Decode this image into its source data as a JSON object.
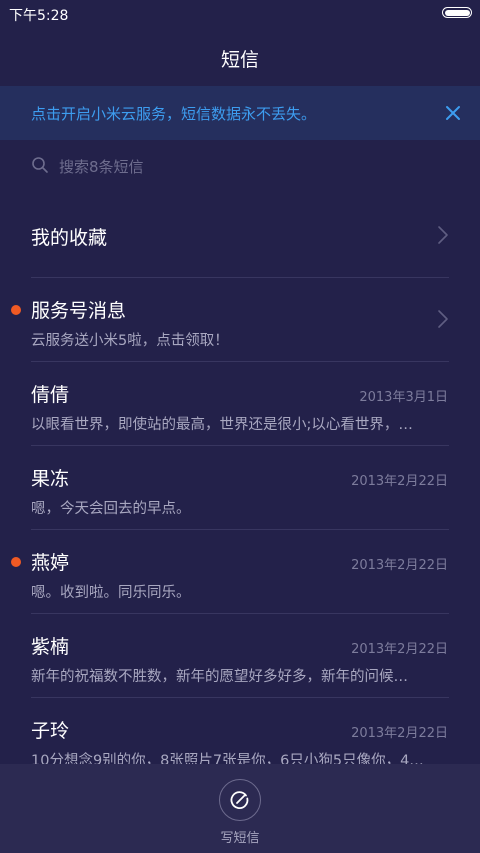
{
  "status_bar": {
    "time": "下午5:28",
    "battery_level": 1.0
  },
  "header": {
    "title": "短信"
  },
  "banner": {
    "text": "点击开启小米云服务，短信数据永不丢失。",
    "accent_color": "#3d9df0"
  },
  "search": {
    "placeholder": "搜索8条短信"
  },
  "favorites": {
    "label": "我的收藏"
  },
  "conversations": [
    {
      "name": "服务号消息",
      "preview": "云服务送小米5啦，点击领取！",
      "date": "",
      "unread": true,
      "has_chevron": true
    },
    {
      "name": "倩倩",
      "preview": "以眼看世界，即使站的最高，世界还是很小;以心看世界，…",
      "date": "2013年3月1日",
      "unread": false
    },
    {
      "name": "果冻",
      "preview": "嗯，今天会回去的早点。",
      "date": "2013年2月22日",
      "unread": false
    },
    {
      "name": "燕婷",
      "preview": "嗯。收到啦。同乐同乐。",
      "date": "2013年2月22日",
      "unread": true
    },
    {
      "name": "紫楠",
      "preview": "新年的祝福数不胜数，新年的愿望好多好多，新年的问候…",
      "date": "2013年2月22日",
      "unread": false
    },
    {
      "name": "子玲",
      "preview": "10分想念9别的你，8张照片7张是你，6只小狗5只像你，4…",
      "date": "2013年2月22日",
      "unread": false
    }
  ],
  "compose": {
    "label": "写短信",
    "icon": "compose-icon"
  },
  "colors": {
    "background": "#23214a",
    "unread_dot": "#f05a24"
  }
}
